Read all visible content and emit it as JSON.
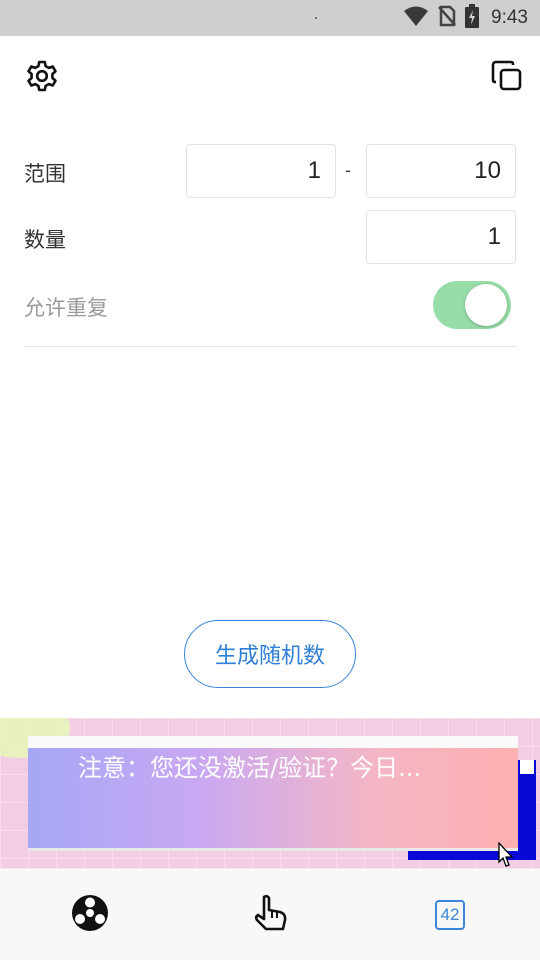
{
  "status_bar": {
    "time": "9:43",
    "icons": [
      "wifi-icon",
      "no-sim-icon",
      "battery-charging-icon"
    ]
  },
  "toolbar": {
    "settings_icon": "gear-icon",
    "copy_icon": "copy-icon"
  },
  "form": {
    "range_label": "范围",
    "range_min": "1",
    "range_separator": "-",
    "range_max": "10",
    "count_label": "数量",
    "count_value": "1",
    "allow_repeat_label": "允许重复",
    "allow_repeat_on": true
  },
  "generate_button": "生成随机数",
  "ad": {
    "text": "注意：您还没激活/验证？今日..."
  },
  "bottom_nav": {
    "items": [
      {
        "icon": "wheel-icon"
      },
      {
        "icon": "pointer-hand-icon"
      },
      {
        "icon": "number-badge-icon",
        "label": "42"
      }
    ]
  },
  "colors": {
    "accent": "#3b86d8",
    "toggle_on": "#97dda7"
  }
}
